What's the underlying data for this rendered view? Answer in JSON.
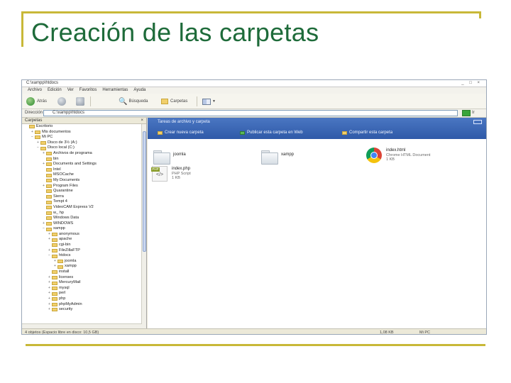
{
  "slide": {
    "title": "Creación de las carpetas",
    "accent_color": "#c8b838",
    "title_color": "#1e6b3a"
  },
  "window": {
    "title": "C:\\xampp\\htdocs",
    "controls": "_ □ ×"
  },
  "menu": [
    "Archivo",
    "Edición",
    "Ver",
    "Favoritos",
    "Herramientas",
    "Ayuda"
  ],
  "toolbar": {
    "back_label": "Atrás",
    "search_label": "Búsqueda",
    "folders_label": "Carpetas",
    "views_icon": "views-icon"
  },
  "address": {
    "label": "Dirección",
    "value": "C:\\xampp\\htdocs",
    "go_label": "Ir"
  },
  "tree": {
    "header": "Carpetas",
    "close": "×",
    "items": [
      {
        "label": "Escritorio",
        "indent": 0,
        "expander": ""
      },
      {
        "label": "Mis documentos",
        "indent": 1,
        "expander": "+"
      },
      {
        "label": "Mi PC",
        "indent": 1,
        "expander": "−"
      },
      {
        "label": "Disco de 3½ (A:)",
        "indent": 2,
        "expander": "+"
      },
      {
        "label": "Disco local (C:)",
        "indent": 2,
        "expander": "−"
      },
      {
        "label": "Archivos de programa",
        "indent": 3,
        "expander": "+"
      },
      {
        "label": "bin",
        "indent": 3,
        "expander": ""
      },
      {
        "label": "Documents and Settings",
        "indent": 3,
        "expander": "+"
      },
      {
        "label": "Intel",
        "indent": 3,
        "expander": ""
      },
      {
        "label": "MSOCache",
        "indent": 3,
        "expander": ""
      },
      {
        "label": "My Documents",
        "indent": 3,
        "expander": ""
      },
      {
        "label": "Program Files",
        "indent": 3,
        "expander": "+"
      },
      {
        "label": "Quarantine",
        "indent": 3,
        "expander": ""
      },
      {
        "label": "Sierra",
        "indent": 3,
        "expander": ""
      },
      {
        "label": "Tempt 4",
        "indent": 3,
        "expander": ""
      },
      {
        "label": "VideoCAM Express V2",
        "indent": 3,
        "expander": ""
      },
      {
        "label": "w_ hp",
        "indent": 3,
        "expander": ""
      },
      {
        "label": "Windows Data",
        "indent": 3,
        "expander": ""
      },
      {
        "label": "WINDOWS",
        "indent": 3,
        "expander": "+"
      },
      {
        "label": "xampp",
        "indent": 3,
        "expander": "−"
      },
      {
        "label": "anonymous",
        "indent": 4,
        "expander": "+"
      },
      {
        "label": "apache",
        "indent": 4,
        "expander": "+"
      },
      {
        "label": "cgi-bin",
        "indent": 4,
        "expander": ""
      },
      {
        "label": "FileZillaFTP",
        "indent": 4,
        "expander": "+"
      },
      {
        "label": "htdocs",
        "indent": 4,
        "expander": "−"
      },
      {
        "label": "joomla",
        "indent": 5,
        "expander": "+"
      },
      {
        "label": "xampp",
        "indent": 5,
        "expander": "+"
      },
      {
        "label": "install",
        "indent": 4,
        "expander": ""
      },
      {
        "label": "licenses",
        "indent": 4,
        "expander": "+"
      },
      {
        "label": "MercuryMail",
        "indent": 4,
        "expander": "+"
      },
      {
        "label": "mysql",
        "indent": 4,
        "expander": "+"
      },
      {
        "label": "perl",
        "indent": 4,
        "expander": "+"
      },
      {
        "label": "php",
        "indent": 4,
        "expander": "+"
      },
      {
        "label": "phpMyAdmin",
        "indent": 4,
        "expander": "+"
      },
      {
        "label": "security",
        "indent": 4,
        "expander": "+"
      }
    ]
  },
  "tasks": {
    "title": "Tareas de archivo y carpeta",
    "items": [
      {
        "label": "Crear nueva carpeta",
        "icon": "new-folder-icon"
      },
      {
        "label": "Publicar esta carpeta en Web",
        "icon": "publish-web-icon"
      },
      {
        "label": "Compartir esta carpeta",
        "icon": "share-folder-icon"
      }
    ]
  },
  "files": [
    {
      "name": "joomla",
      "sub": "",
      "icon": "folder-icon"
    },
    {
      "name": "xampp",
      "sub": "",
      "icon": "folder-icon"
    },
    {
      "name": "index.html",
      "sub": "Chrome HTML Document\n1 KB",
      "icon": "chrome-icon"
    },
    {
      "name": "index.php",
      "sub": "PHP Script\n1 KB",
      "icon": "php-file-icon"
    }
  ],
  "status": {
    "left": "4 objetos (Espacio libre en disco: 10,5 GB)",
    "size": "1,08 KB",
    "location": "Mi PC"
  }
}
